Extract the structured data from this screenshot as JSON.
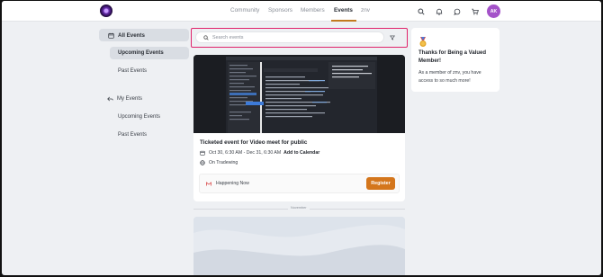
{
  "nav": {
    "links": [
      "Community",
      "Sponsors",
      "Members",
      "Events",
      "znv"
    ],
    "active": "Events",
    "avatar_initials": "AK",
    "icons": [
      "search-icon",
      "bell-icon",
      "chat-icon",
      "cart-icon"
    ],
    "accent_color": "#c27a1e"
  },
  "sidebar": {
    "all_events": "All Events",
    "all_sub": [
      "Upcoming Events",
      "Past Events"
    ],
    "my_events": "My Events",
    "my_sub": [
      "Upcoming Events",
      "Past Events"
    ]
  },
  "search": {
    "placeholder": "Search events"
  },
  "event": {
    "title": "Ticketed event for Video meet for public",
    "date": "Oct 30, 6:30 AM - Dec 31, 6:30 AM",
    "add_to_calendar": "Add to Calendar",
    "location": "On Tradewing",
    "status": "Happening Now",
    "register_label": "Register",
    "register_color": "#d4761c"
  },
  "divider": {
    "month": "November"
  },
  "member_card": {
    "title": "Thanks for Being a Valued Member!",
    "text": "As a member of znv, you have access to so much more!"
  }
}
